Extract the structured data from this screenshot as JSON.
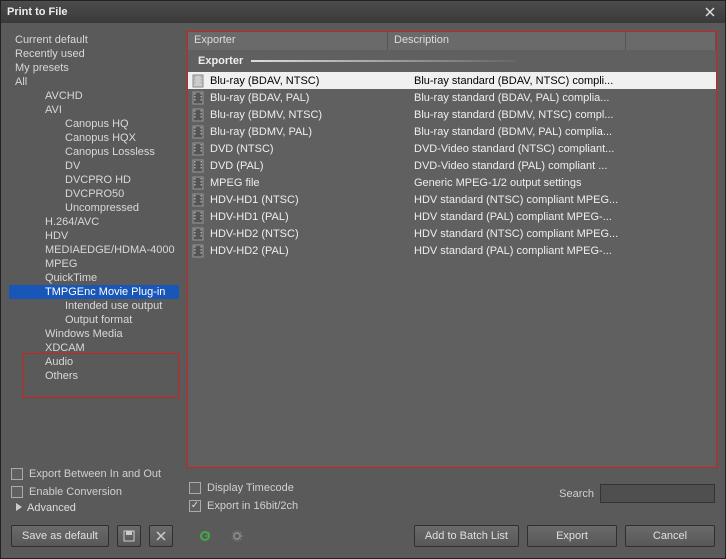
{
  "title": "Print to File",
  "tree": [
    {
      "label": "Current default",
      "level": 0
    },
    {
      "label": "Recently used",
      "level": 0
    },
    {
      "label": "My presets",
      "level": 0
    },
    {
      "label": "All",
      "level": 0
    },
    {
      "label": "AVCHD",
      "level": 1
    },
    {
      "label": "AVI",
      "level": 1
    },
    {
      "label": "Canopus HQ",
      "level": 2
    },
    {
      "label": "Canopus HQX",
      "level": 2
    },
    {
      "label": "Canopus Lossless",
      "level": 2
    },
    {
      "label": "DV",
      "level": 2
    },
    {
      "label": "DVCPRO HD",
      "level": 2
    },
    {
      "label": "DVCPRO50",
      "level": 2
    },
    {
      "label": "Uncompressed",
      "level": 2
    },
    {
      "label": "H.264/AVC",
      "level": 1
    },
    {
      "label": "HDV",
      "level": 1
    },
    {
      "label": "MEDIAEDGE/HDMA-4000",
      "level": 1
    },
    {
      "label": "MPEG",
      "level": 1
    },
    {
      "label": "QuickTime",
      "level": 1
    },
    {
      "label": "TMPGEnc Movie Plug-in",
      "level": 1,
      "selected": true
    },
    {
      "label": "Intended use output",
      "level": 2
    },
    {
      "label": "Output format",
      "level": 2
    },
    {
      "label": "Windows Media",
      "level": 1
    },
    {
      "label": "XDCAM",
      "level": 1
    },
    {
      "label": "Audio",
      "level": 1
    },
    {
      "label": "Others",
      "level": 1
    }
  ],
  "columns": {
    "exporter": "Exporter",
    "description": "Description"
  },
  "group_label": "Exporter",
  "rows": [
    {
      "name": "Blu-ray (BDAV, NTSC)",
      "desc": "Blu-ray standard (BDAV, NTSC) compli...",
      "selected": true
    },
    {
      "name": "Blu-ray (BDAV, PAL)",
      "desc": "Blu-ray standard (BDAV, PAL) complia..."
    },
    {
      "name": "Blu-ray (BDMV, NTSC)",
      "desc": "Blu-ray standard (BDMV, NTSC) compl..."
    },
    {
      "name": "Blu-ray (BDMV, PAL)",
      "desc": "Blu-ray standard (BDMV, PAL) complia..."
    },
    {
      "name": "DVD (NTSC)",
      "desc": "DVD-Video standard (NTSC) compliant..."
    },
    {
      "name": "DVD (PAL)",
      "desc": "DVD-Video standard (PAL) compliant ..."
    },
    {
      "name": "MPEG file",
      "desc": "Generic MPEG-1/2 output settings"
    },
    {
      "name": "HDV-HD1 (NTSC)",
      "desc": "HDV standard (NTSC) compliant MPEG..."
    },
    {
      "name": "HDV-HD1 (PAL)",
      "desc": "HDV standard (PAL) compliant MPEG-..."
    },
    {
      "name": "HDV-HD2 (NTSC)",
      "desc": "HDV standard (NTSC) compliant MPEG..."
    },
    {
      "name": "HDV-HD2 (PAL)",
      "desc": "HDV standard (PAL) compliant MPEG-..."
    }
  ],
  "checks": {
    "export_between": "Export Between In and Out",
    "enable_conv": "Enable Conversion",
    "display_tc": "Display Timecode",
    "export_16bit": "Export in 16bit/2ch"
  },
  "search_label": "Search",
  "advanced": "Advanced",
  "buttons": {
    "save_default": "Save as default",
    "add_batch": "Add to Batch List",
    "export": "Export",
    "cancel": "Cancel"
  }
}
